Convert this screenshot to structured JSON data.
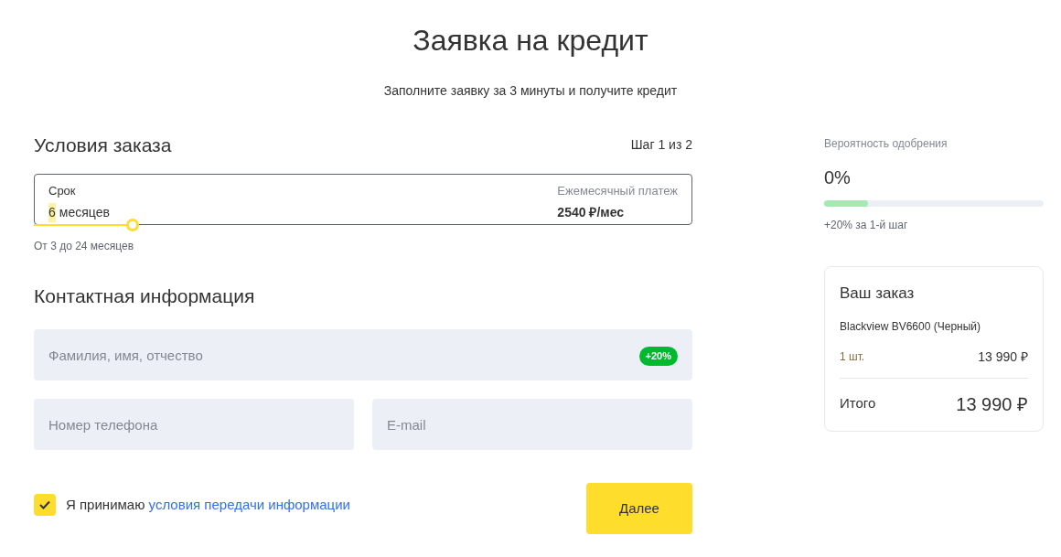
{
  "header": {
    "title": "Заявка на кредит",
    "subtitle": "Заполните заявку за 3 минуты и получите кредит"
  },
  "order_terms": {
    "heading": "Условия заказа",
    "step": "Шаг 1 из 2",
    "term": {
      "label": "Срок",
      "value_number": "6",
      "value_unit": "месяцев",
      "level": 0.15
    },
    "payment": {
      "label": "Ежемесячный платеж",
      "value": "2540 ₽/мес"
    },
    "hint": "От 3 до 24 месяцев"
  },
  "contact": {
    "heading": "Контактная информация",
    "fields": [
      {
        "placeholder": "Фамилия, имя, отчество",
        "badge": "+20%"
      },
      {
        "placeholder": "Номер телефона"
      },
      {
        "placeholder": "E-mail"
      }
    ]
  },
  "consent": {
    "checked": true,
    "text": "Я принимаю",
    "link": "условия передачи информации"
  },
  "next_button": "Далее",
  "approval": {
    "label": "Вероятность одобрения",
    "value": "0%",
    "level": 0.2,
    "note": "+20% за 1-й шаг"
  },
  "order": {
    "title": "Ваш заказ",
    "product": "Blackview BV6600 (Черный)",
    "quantity": "1 шт.",
    "price": "13 990 ₽",
    "total_label": "Итого",
    "total": "13 990 ₽"
  }
}
